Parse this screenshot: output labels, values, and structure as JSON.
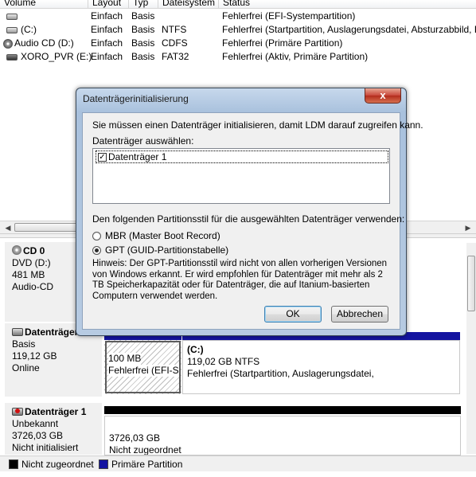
{
  "volume_list": {
    "columns": [
      "Volume",
      "Layout",
      "Typ",
      "Dateisystem",
      "Status"
    ],
    "rows": [
      {
        "name": "",
        "layout": "Einfach",
        "typ": "Basis",
        "fs": "",
        "status": "Fehlerfrei (EFI-Systempartition)"
      },
      {
        "name": "(C:)",
        "layout": "Einfach",
        "typ": "Basis",
        "fs": "NTFS",
        "status": "Fehlerfrei (Startpartition, Auslagerungsdatei, Absturzabbild, Pri"
      },
      {
        "name": "Audio CD (D:)",
        "layout": "Einfach",
        "typ": "Basis",
        "fs": "CDFS",
        "status": "Fehlerfrei (Primäre Partition)"
      },
      {
        "name": "XORO_PVR (E:)",
        "layout": "Einfach",
        "typ": "Basis",
        "fs": "FAT32",
        "status": "Fehlerfrei (Aktiv, Primäre Partition)"
      }
    ]
  },
  "disks": {
    "cd0": {
      "title": "CD 0",
      "line1": "DVD (D:)",
      "line2": "481 MB",
      "line3": "Audio-CD"
    },
    "disk0": {
      "title": "Datenträger 0",
      "line1": "Basis",
      "line2": "119,12 GB",
      "line3": "Online",
      "p1": {
        "line1": "100 MB",
        "line2": "Fehlerfrei (EFI-S"
      },
      "p2": {
        "line0": "(C:)",
        "line1": "119,02 GB NTFS",
        "line2": "Fehlerfrei (Startpartition, Auslagerungsdatei,"
      }
    },
    "disk1": {
      "title": "Datenträger 1",
      "line1": "Unbekannt",
      "line2": "3726,03 GB",
      "line3": "Nicht initialisiert",
      "p1": {
        "line1": "3726,03 GB",
        "line2": "Nicht zugeordnet"
      }
    }
  },
  "legend": {
    "unallocated": "Nicht zugeordnet",
    "primary": "Primäre Partition"
  },
  "colors": {
    "unallocated": "#000000",
    "primary": "#1414a0"
  },
  "dialog": {
    "title": "Datenträgerinitialisierung",
    "close": "x",
    "intro": "Sie müssen einen Datenträger initialisieren, damit LDM darauf zugreifen kann.",
    "select_label": "Datenträger auswählen:",
    "disk_item": "Datenträger 1",
    "style_label": "Den folgenden Partitionsstil für die ausgewählten Datenträger verwenden:",
    "mbr": "MBR (Master Boot Record)",
    "gpt": "GPT (GUID-Partitionstabelle)",
    "selected_style": "GPT",
    "hint": "Hinweis: Der GPT-Partitionsstil wird nicht von allen vorherigen Versionen von Windows erkannt. Er wird empfohlen für Datenträger mit mehr als 2 TB Speicherkapazität oder für Datenträger, die auf Itanium-basierten Computern verwendet werden.",
    "ok": "OK",
    "cancel": "Abbrechen"
  }
}
